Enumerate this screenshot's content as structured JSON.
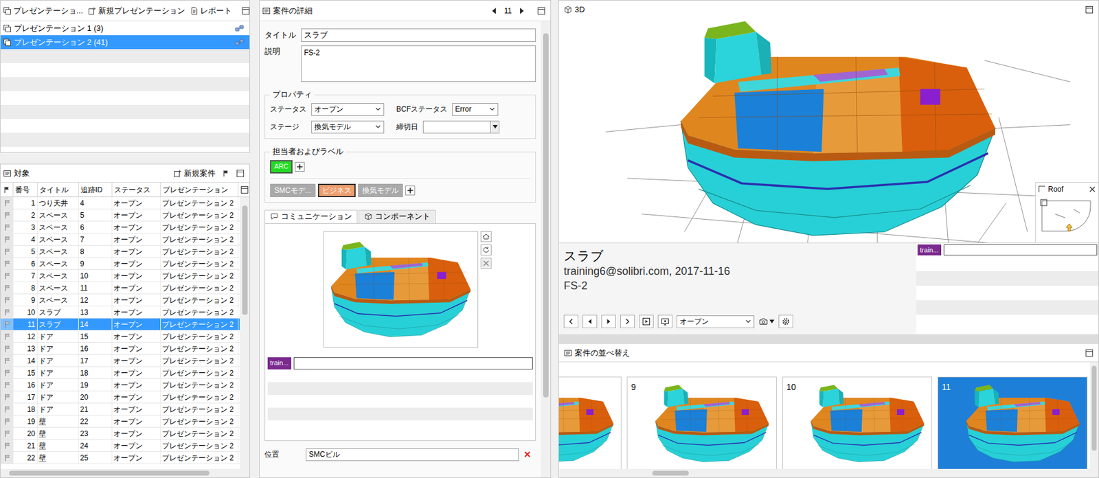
{
  "presentations": {
    "toolbar": [
      {
        "label": "プレゼンテーショ..."
      },
      {
        "label": "新規プレゼンテーション"
      },
      {
        "label": "レポート"
      }
    ],
    "items": [
      {
        "label": "プレゼンテーション 1 (3)",
        "selected": false
      },
      {
        "label": "プレゼンテーション 2 (41)",
        "selected": true
      }
    ]
  },
  "issues": {
    "title": "対象",
    "new_button": "新規案件",
    "columns": [
      "番号",
      "タイトル",
      "追跡ID",
      "ステータス",
      "プレゼンテーション"
    ],
    "rows": [
      {
        "cells": [
          "1",
          "つり天井",
          "4",
          "オープン",
          "プレゼンテーション 2"
        ],
        "selected": false
      },
      {
        "cells": [
          "2",
          "スペース",
          "5",
          "オープン",
          "プレゼンテーション 2"
        ],
        "selected": false
      },
      {
        "cells": [
          "3",
          "スペース",
          "6",
          "オープン",
          "プレゼンテーション 2"
        ],
        "selected": false
      },
      {
        "cells": [
          "4",
          "スペース",
          "7",
          "オープン",
          "プレゼンテーション 2"
        ],
        "selected": false
      },
      {
        "cells": [
          "5",
          "スペース",
          "8",
          "オープン",
          "プレゼンテーション 2"
        ],
        "selected": false
      },
      {
        "cells": [
          "6",
          "スペース",
          "9",
          "オープン",
          "プレゼンテーション 2"
        ],
        "selected": false
      },
      {
        "cells": [
          "7",
          "スペース",
          "10",
          "オープン",
          "プレゼンテーション 2"
        ],
        "selected": false
      },
      {
        "cells": [
          "8",
          "スペース",
          "11",
          "オープン",
          "プレゼンテーション 2"
        ],
        "selected": false
      },
      {
        "cells": [
          "9",
          "スペース",
          "12",
          "オープン",
          "プレゼンテーション 2"
        ],
        "selected": false
      },
      {
        "cells": [
          "10",
          "スラブ",
          "13",
          "オープン",
          "プレゼンテーション 2"
        ],
        "selected": false
      },
      {
        "cells": [
          "11",
          "スラブ",
          "14",
          "オープン",
          "プレゼンテーション 2"
        ],
        "selected": true
      },
      {
        "cells": [
          "12",
          "ドア",
          "15",
          "オープン",
          "プレゼンテーション 2"
        ],
        "selected": false
      },
      {
        "cells": [
          "13",
          "ドア",
          "16",
          "オープン",
          "プレゼンテーション 2"
        ],
        "selected": false
      },
      {
        "cells": [
          "14",
          "ドア",
          "17",
          "オープン",
          "プレゼンテーション 2"
        ],
        "selected": false
      },
      {
        "cells": [
          "15",
          "ドア",
          "18",
          "オープン",
          "プレゼンテーション 2"
        ],
        "selected": false
      },
      {
        "cells": [
          "16",
          "ドア",
          "19",
          "オープン",
          "プレゼンテーション 2"
        ],
        "selected": false
      },
      {
        "cells": [
          "17",
          "ドア",
          "20",
          "オープン",
          "プレゼンテーション 2"
        ],
        "selected": false
      },
      {
        "cells": [
          "18",
          "ドア",
          "21",
          "オープン",
          "プレゼンテーション 2"
        ],
        "selected": false
      },
      {
        "cells": [
          "19",
          "壁",
          "22",
          "オープン",
          "プレゼンテーション 2"
        ],
        "selected": false
      },
      {
        "cells": [
          "20",
          "壁",
          "23",
          "オープン",
          "プレゼンテーション 2"
        ],
        "selected": false
      },
      {
        "cells": [
          "21",
          "壁",
          "24",
          "オープン",
          "プレゼンテーション 2"
        ],
        "selected": false
      },
      {
        "cells": [
          "22",
          "壁",
          "25",
          "オープン",
          "プレゼンテーション 2"
        ],
        "selected": false
      }
    ]
  },
  "details": {
    "title": "案件の詳細",
    "counter": "11",
    "title_label": "タイトル",
    "title_value": "スラブ",
    "description_label": "説明",
    "description_value": "FS-2",
    "properties": {
      "legend": "プロパティ",
      "status_label": "ステータス",
      "status_value": "オープン",
      "bcf_label": "BCFステータス",
      "bcf_value": "Error",
      "stage_label": "ステージ",
      "stage_value": "換気モデル",
      "due_label": "締切日"
    },
    "people": {
      "legend": "担当者およびラベル",
      "assignees": [
        {
          "label": "ARC",
          "color": "#22dd22"
        }
      ],
      "labels": [
        {
          "label": "SMCモデ...",
          "selected": false
        },
        {
          "label": "ビジネス",
          "selected": true
        },
        {
          "label": "換気モデル",
          "selected": false
        }
      ]
    },
    "tabs": [
      {
        "label": "コミュニケーション",
        "selected": true
      },
      {
        "label": "コンポーネント",
        "selected": false
      }
    ],
    "comments": [
      {
        "author": "train..."
      }
    ],
    "location_label": "位置",
    "location_value": "SMCビル"
  },
  "view3d": {
    "title": "3D",
    "minimap_label": "Roof"
  },
  "issue_card": {
    "title": "スラブ",
    "meta": "training6@solibri.com, 2017-11-16",
    "description": "FS-2",
    "status_value": "オープン",
    "comments": [
      {
        "author": "train..."
      }
    ]
  },
  "sorter": {
    "title": "案件の並べ替え",
    "cards": [
      {
        "number": "",
        "selected": false
      },
      {
        "number": "9",
        "selected": false
      },
      {
        "number": "10",
        "selected": false
      },
      {
        "number": "11",
        "selected": true
      }
    ]
  }
}
